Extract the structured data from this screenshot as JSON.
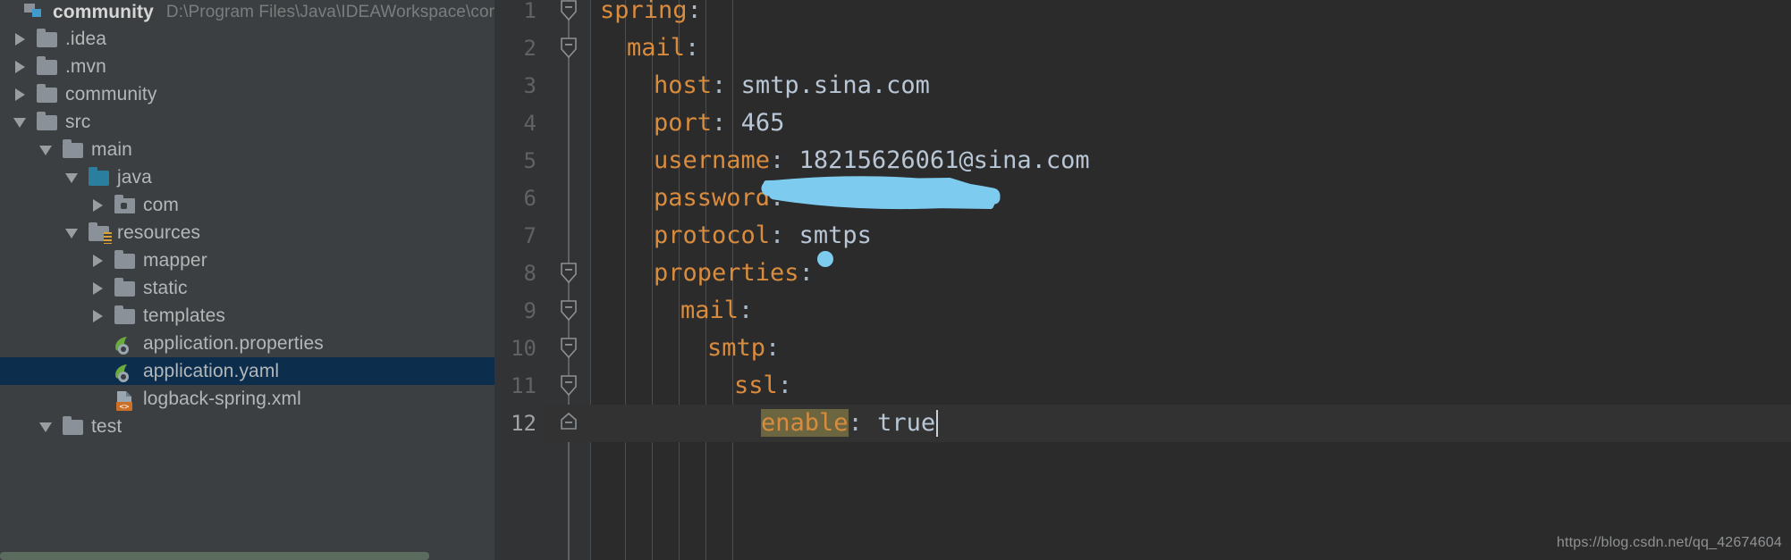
{
  "project_panel": {
    "header": {
      "name": "community",
      "path": "D:\\Program Files\\Java\\IDEAWorkspace\\comm"
    },
    "items": [
      {
        "label": ".idea",
        "icon": "folder-icon",
        "indent": 0,
        "state": "collapsed",
        "selected": false
      },
      {
        "label": ".mvn",
        "icon": "folder-icon",
        "indent": 0,
        "state": "collapsed",
        "selected": false
      },
      {
        "label": "community",
        "icon": "folder-icon",
        "indent": 0,
        "state": "collapsed",
        "selected": false
      },
      {
        "label": "src",
        "icon": "folder-icon",
        "indent": 0,
        "state": "expanded",
        "selected": false
      },
      {
        "label": "main",
        "icon": "folder-icon",
        "indent": 1,
        "state": "expanded",
        "selected": false
      },
      {
        "label": "java",
        "icon": "source-folder-icon",
        "indent": 2,
        "state": "expanded",
        "selected": false
      },
      {
        "label": "com",
        "icon": "package-icon",
        "indent": 3,
        "state": "collapsed",
        "selected": false
      },
      {
        "label": "resources",
        "icon": "resource-folder-icon",
        "indent": 2,
        "state": "expanded",
        "selected": false
      },
      {
        "label": "mapper",
        "icon": "folder-icon",
        "indent": 3,
        "state": "collapsed",
        "selected": false
      },
      {
        "label": "static",
        "icon": "folder-icon",
        "indent": 3,
        "state": "collapsed",
        "selected": false
      },
      {
        "label": "templates",
        "icon": "folder-icon",
        "indent": 3,
        "state": "collapsed",
        "selected": false
      },
      {
        "label": "application.properties",
        "icon": "spring-config-icon",
        "indent": 3,
        "state": "leaf",
        "selected": false
      },
      {
        "label": "application.yaml",
        "icon": "spring-config-icon",
        "indent": 3,
        "state": "leaf",
        "selected": true
      },
      {
        "label": "logback-spring.xml",
        "icon": "xml-file-icon",
        "indent": 3,
        "state": "leaf",
        "selected": false
      },
      {
        "label": "test",
        "icon": "folder-icon",
        "indent": 1,
        "state": "expanded",
        "selected": false
      }
    ]
  },
  "editor": {
    "file": "application.yaml",
    "current_line": 12,
    "lines": [
      {
        "no": "1",
        "indent": 0,
        "key": "spring",
        "sep": ":",
        "value": "",
        "fold": "start"
      },
      {
        "no": "2",
        "indent": 1,
        "key": "mail",
        "sep": ":",
        "value": "",
        "fold": "start"
      },
      {
        "no": "3",
        "indent": 2,
        "key": "host",
        "sep": ":",
        "value": "smtp.sina.com",
        "fold": ""
      },
      {
        "no": "4",
        "indent": 2,
        "key": "port",
        "sep": ":",
        "value": "465",
        "fold": ""
      },
      {
        "no": "5",
        "indent": 2,
        "key": "username",
        "sep": ":",
        "value": "18215626061@sina.com",
        "fold": ""
      },
      {
        "no": "6",
        "indent": 2,
        "key": "password",
        "sep": ":",
        "value": "",
        "fold": "",
        "redacted": true
      },
      {
        "no": "7",
        "indent": 2,
        "key": "protocol",
        "sep": ":",
        "value": "smtps",
        "fold": ""
      },
      {
        "no": "8",
        "indent": 2,
        "key": "properties",
        "sep": ":",
        "value": "",
        "fold": "start"
      },
      {
        "no": "9",
        "indent": 3,
        "key": "mail",
        "sep": ":",
        "value": "",
        "fold": "start"
      },
      {
        "no": "10",
        "indent": 4,
        "key": "smtp",
        "sep": ":",
        "value": "",
        "fold": "start"
      },
      {
        "no": "11",
        "indent": 5,
        "key": "ssl",
        "sep": ":",
        "value": "",
        "fold": "start"
      },
      {
        "no": "12",
        "indent": 6,
        "key": "enable",
        "sep": ":",
        "value": "true",
        "fold": "end",
        "highlight_key": true
      }
    ]
  },
  "annotation": {
    "redaction_color": "#7ecbf0",
    "dot_color": "#7ecbf0"
  },
  "watermark": {
    "text": "https://blog.csdn.net/qq_42674604"
  },
  "colors": {
    "editor_background": "#2b2b2b",
    "gutter_background": "#313335",
    "panel_background": "#3c3f41",
    "selection_background": "#0d2d4d",
    "yaml_key": "#d98c3e",
    "yaml_value": "#b8c6d6",
    "caret_line": "#323232",
    "identifier_highlight": "#6b6540",
    "source_folder": "#2b7f9e",
    "spring_green": "#6aab3d",
    "xml_orange": "#cc7832"
  }
}
